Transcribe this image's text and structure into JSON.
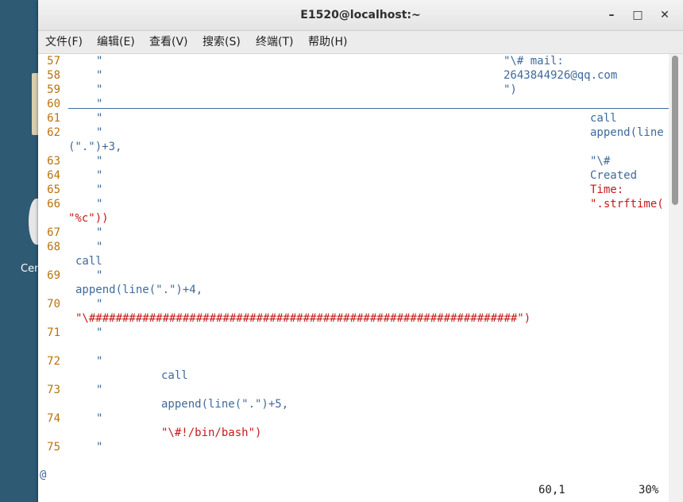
{
  "desktop": {
    "icon_label": "Cen"
  },
  "window": {
    "title": "E1520@localhost:~",
    "minimize": "–",
    "maximize": "□",
    "close": "✕"
  },
  "menu": [
    "文件(F)",
    "编辑(E)",
    "查看(V)",
    "搜索(S)",
    "终端(T)",
    "帮助(H)"
  ],
  "terminal": {
    "line_numbers": [
      "57",
      "58",
      "59",
      "60",
      "61",
      "62",
      "63",
      "64",
      "65",
      "66",
      "67",
      "68",
      "69",
      "70",
      "71",
      "72",
      "73",
      "74",
      "75"
    ],
    "quote": "\"",
    "mail_1": "\"\\# mail:",
    "mail_2": "2643844926@qq.com",
    "mail_3": "\")",
    "call": "call",
    "append_line": "append(line",
    "plus3": "(\".\")+3,",
    "hash": "\"\\#",
    "created": "Created",
    "time": "Time:",
    "strftime": "\".strftime(",
    "pct_c": "\"%c\"))",
    "append4": "append(line(\".\")+4,",
    "hashline": "\"\\################################################################\")",
    "append5": "append(line(\".\")+5,",
    "bash": "\"\\#!/bin/bash\")",
    "at_sign": "@",
    "position": "60,1",
    "percent": "30%"
  }
}
